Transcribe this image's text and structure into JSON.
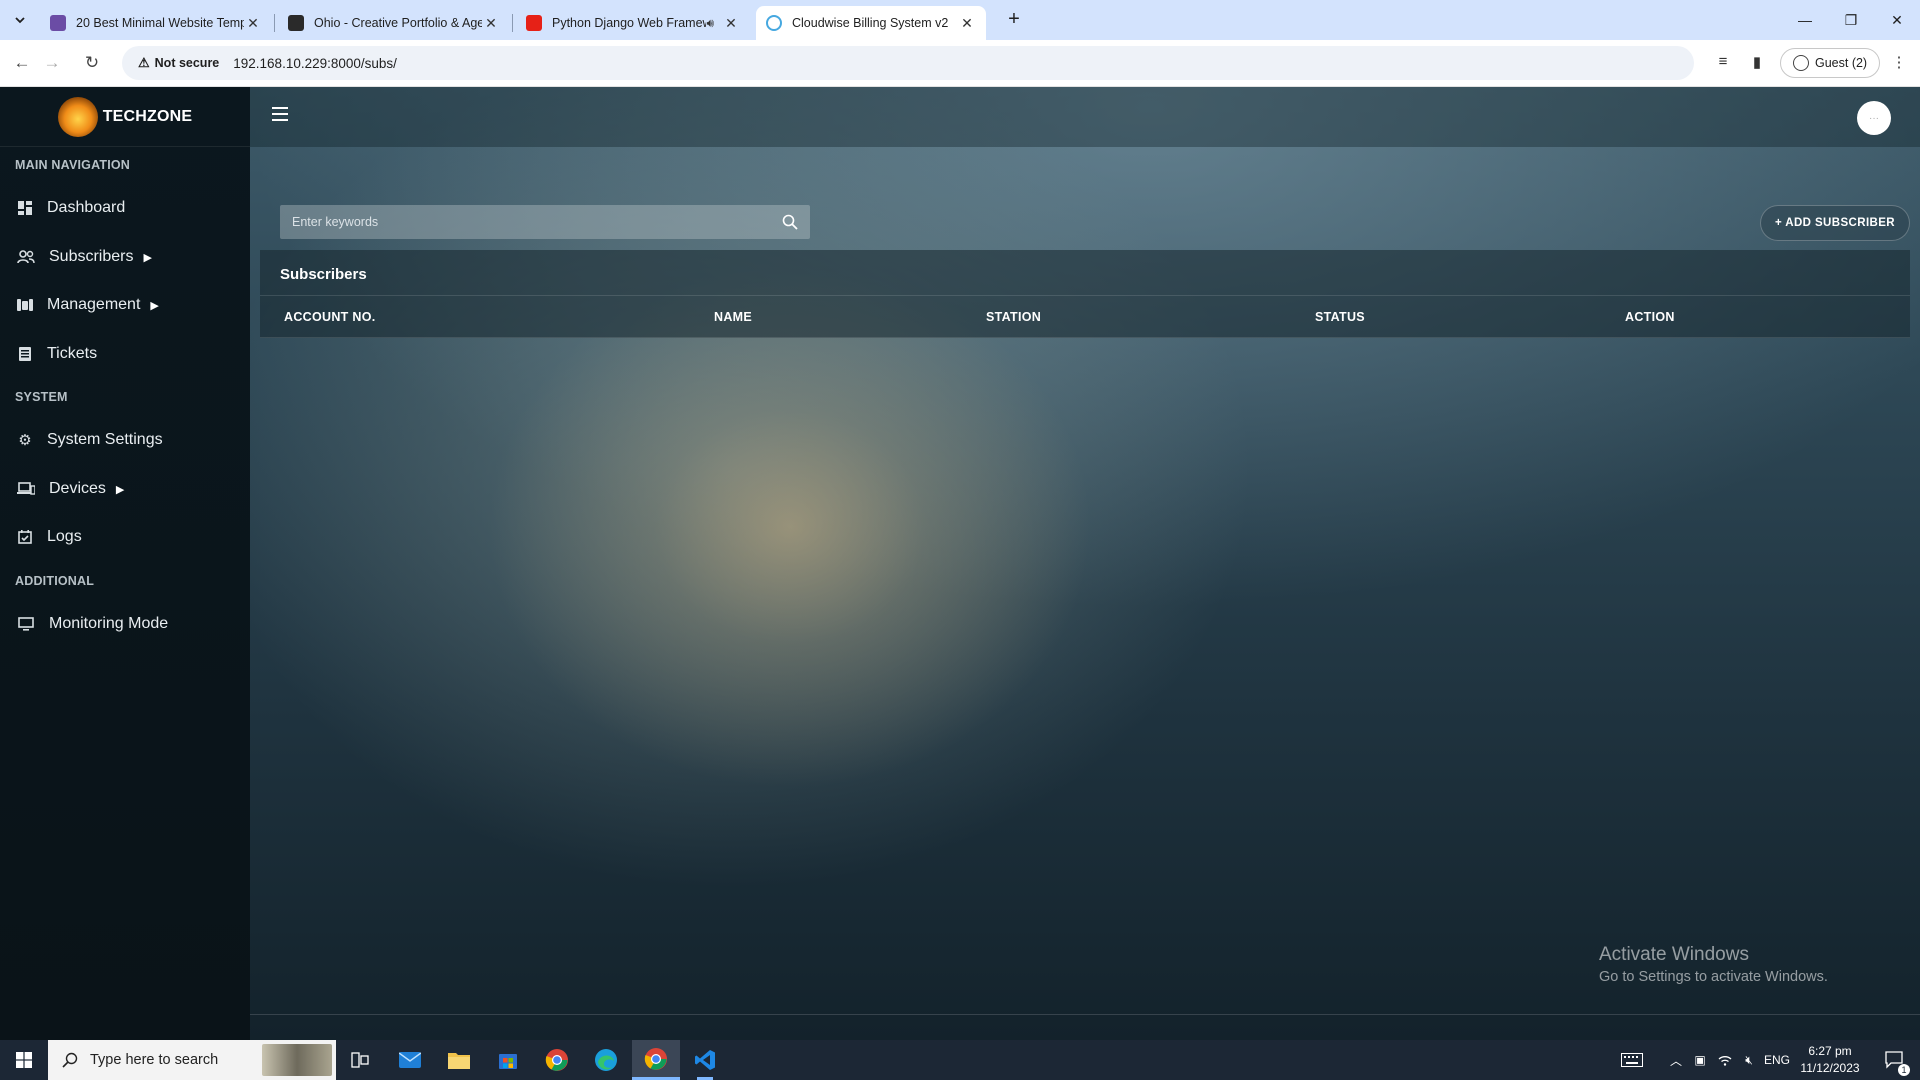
{
  "browser": {
    "tabs": [
      {
        "title": "20 Best Minimal Website Templ",
        "color": "#6b4ca5",
        "active": false
      },
      {
        "title": "Ohio - Creative Portfolio & Age",
        "color": "#2a2a2a",
        "active": false
      },
      {
        "title": "Python Django Web Framew",
        "color": "#e62117",
        "active": false,
        "audio": true
      },
      {
        "title": "Cloudwise Billing System v2",
        "color": "#46a8e0",
        "active": true
      }
    ],
    "security_label": "Not secure",
    "url": "192.168.10.229:8000/subs/",
    "profile_label": "Guest (2)"
  },
  "sidebar": {
    "brand": "TECHZONE",
    "sections": [
      {
        "title": "MAIN NAVIGATION",
        "items": [
          {
            "label": "Dashboard",
            "icon": "dashboard-icon",
            "has_caret": false
          },
          {
            "label": "Subscribers",
            "icon": "users-icon",
            "has_caret": true
          },
          {
            "label": "Management",
            "icon": "management-icon",
            "has_caret": true
          },
          {
            "label": "Tickets",
            "icon": "tickets-icon",
            "has_caret": false
          }
        ]
      },
      {
        "title": "SYSTEM",
        "items": [
          {
            "label": "System Settings",
            "icon": "gear-icon",
            "has_caret": false
          },
          {
            "label": "Devices",
            "icon": "devices-icon",
            "has_caret": true
          },
          {
            "label": "Logs",
            "icon": "logs-icon",
            "has_caret": false
          }
        ]
      },
      {
        "title": "ADDITIONAL",
        "items": [
          {
            "label": "Monitoring Mode",
            "icon": "monitor-icon",
            "has_caret": false
          }
        ]
      }
    ]
  },
  "main": {
    "search_placeholder": "Enter keywords",
    "add_button_label": "+ ADD SUBSCRIBER",
    "card_title": "Subscribers",
    "columns": [
      "ACCOUNT NO.",
      "NAME",
      "STATION",
      "STATUS",
      "ACTION"
    ],
    "rows": []
  },
  "watermark": {
    "line1": "Activate Windows",
    "line2": "Go to Settings to activate Windows."
  },
  "taskbar": {
    "search_placeholder": "Type here to search",
    "language": "ENG",
    "time": "6:27 pm",
    "date": "11/12/2023",
    "notification_count": "1"
  }
}
